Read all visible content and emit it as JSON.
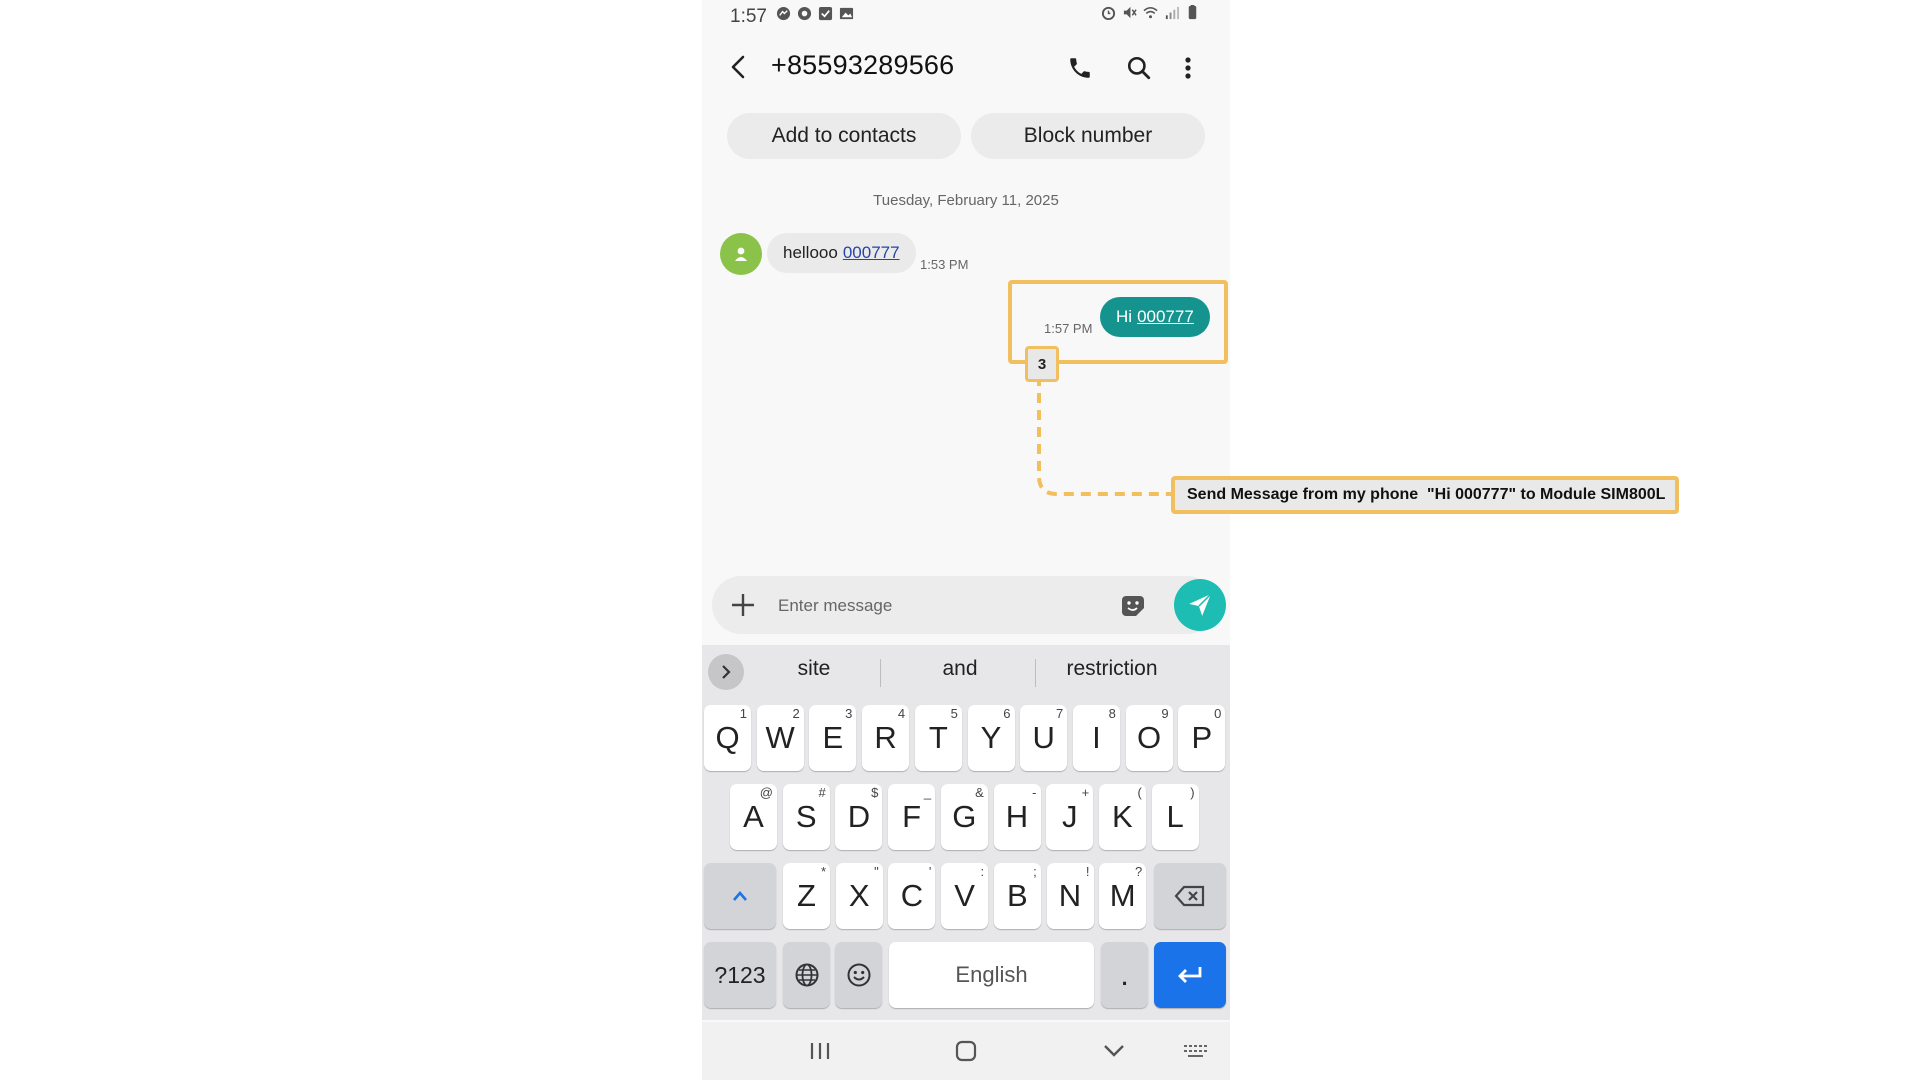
{
  "status_bar": {
    "time": "1:57"
  },
  "header": {
    "title": "+85593289566"
  },
  "actions": {
    "add_contact": "Add to contacts",
    "block": "Block number"
  },
  "conversation": {
    "date": "Tuesday, February 11, 2025",
    "messages": [
      {
        "direction": "incoming",
        "text": "hellooo",
        "link": "000777",
        "time": "1:53 PM"
      },
      {
        "direction": "outgoing",
        "text": "Hi",
        "link": "000777",
        "time": "1:57 PM"
      }
    ]
  },
  "composer": {
    "placeholder": "Enter message"
  },
  "keyboard": {
    "suggestions": [
      "site",
      "and",
      "restriction"
    ],
    "row1": [
      [
        "Q",
        "1"
      ],
      [
        "W",
        "2"
      ],
      [
        "E",
        "3"
      ],
      [
        "R",
        "4"
      ],
      [
        "T",
        "5"
      ],
      [
        "Y",
        "6"
      ],
      [
        "U",
        "7"
      ],
      [
        "I",
        "8"
      ],
      [
        "O",
        "9"
      ],
      [
        "P",
        "0"
      ]
    ],
    "row2": [
      [
        "A",
        "@"
      ],
      [
        "S",
        "#"
      ],
      [
        "D",
        "$"
      ],
      [
        "F",
        "_"
      ],
      [
        "G",
        "&"
      ],
      [
        "H",
        "-"
      ],
      [
        "J",
        "+"
      ],
      [
        "K",
        "("
      ],
      [
        "L",
        ")"
      ]
    ],
    "row3": [
      [
        "Z",
        "*"
      ],
      [
        "X",
        "\""
      ],
      [
        "C",
        "'"
      ],
      [
        "V",
        ":"
      ],
      [
        "B",
        ";"
      ],
      [
        "N",
        "!"
      ],
      [
        "M",
        "?"
      ]
    ],
    "symbols_key": "?123",
    "space_label": "English",
    "period": "."
  },
  "annotation": {
    "badge": "3",
    "label": "Send Message from my phone  \"Hi 000777\" to Module SIM800L",
    "color": "#f2bf5e"
  },
  "colors": {
    "outgoing_bubble": "#15948f",
    "send_button": "#1dbdb4",
    "enter_key": "#1a73e8",
    "avatar": "#8bc34a"
  }
}
